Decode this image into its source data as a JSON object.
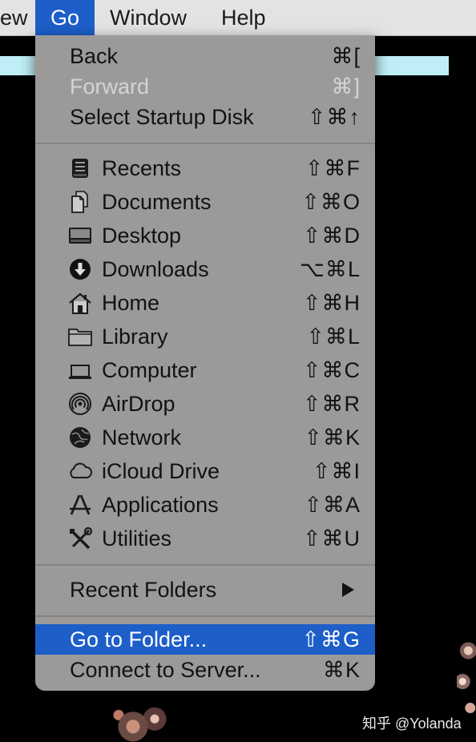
{
  "menubar": {
    "partial_item": "ew",
    "go": "Go",
    "window": "Window",
    "help": "Help"
  },
  "go_menu": {
    "back": {
      "label": "Back",
      "shortcut": "⌘["
    },
    "forward": {
      "label": "Forward",
      "shortcut": "⌘]"
    },
    "startup_disk": {
      "label": "Select Startup Disk",
      "shortcut": "⇧⌘↑"
    },
    "places": [
      {
        "label": "Recents",
        "shortcut": "⇧⌘F",
        "icon": "recents-icon"
      },
      {
        "label": "Documents",
        "shortcut": "⇧⌘O",
        "icon": "documents-icon"
      },
      {
        "label": "Desktop",
        "shortcut": "⇧⌘D",
        "icon": "desktop-icon"
      },
      {
        "label": "Downloads",
        "shortcut": "⌥⌘L",
        "icon": "downloads-icon"
      },
      {
        "label": "Home",
        "shortcut": "⇧⌘H",
        "icon": "home-icon"
      },
      {
        "label": "Library",
        "shortcut": "⇧⌘L",
        "icon": "library-folder-icon"
      },
      {
        "label": "Computer",
        "shortcut": "⇧⌘C",
        "icon": "computer-icon"
      },
      {
        "label": "AirDrop",
        "shortcut": "⇧⌘R",
        "icon": "airdrop-icon"
      },
      {
        "label": "Network",
        "shortcut": "⇧⌘K",
        "icon": "network-globe-icon"
      },
      {
        "label": "iCloud Drive",
        "shortcut": "⇧⌘I",
        "icon": "cloud-icon"
      },
      {
        "label": "Applications",
        "shortcut": "⇧⌘A",
        "icon": "applications-icon"
      },
      {
        "label": "Utilities",
        "shortcut": "⇧⌘U",
        "icon": "utilities-tools-icon"
      }
    ],
    "recent_folders": {
      "label": "Recent Folders"
    },
    "go_to_folder": {
      "label": "Go to Folder...",
      "shortcut": "⇧⌘G"
    },
    "connect_server": {
      "label": "Connect to Server...",
      "shortcut": "⌘K"
    }
  },
  "watermark": "知乎 @Yolanda"
}
